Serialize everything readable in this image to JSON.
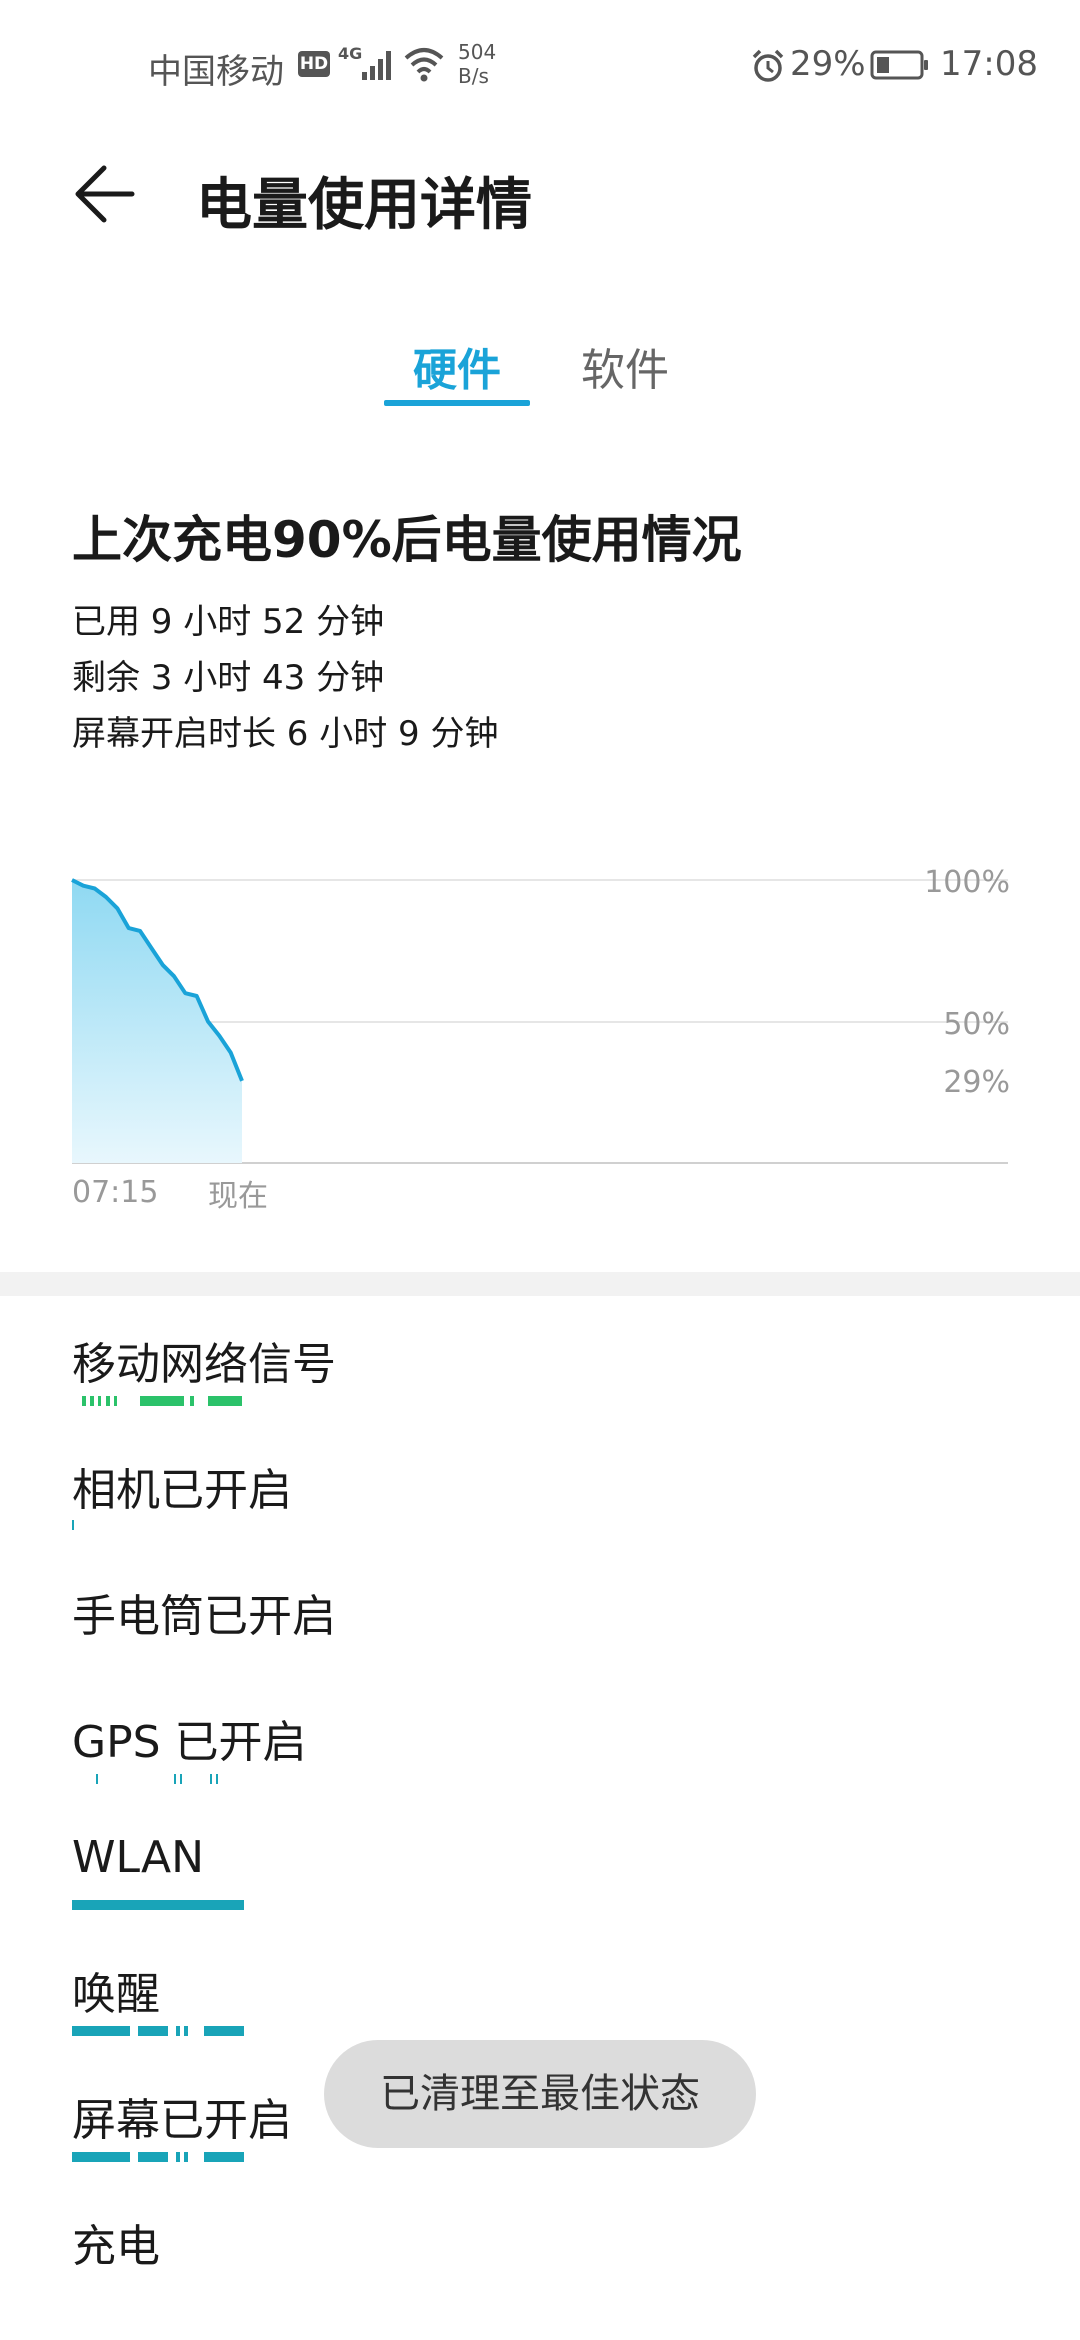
{
  "status_bar": {
    "carrier": "中国移动",
    "hd_badge": "HD",
    "network_type": "4G",
    "net_speed_value": "504",
    "net_speed_unit": "B/s",
    "battery_percent": "29%",
    "time": "17:08",
    "icons": [
      "hd-icon",
      "signal-icon",
      "wifi-icon",
      "alarm-icon",
      "battery-icon"
    ]
  },
  "header": {
    "title": "电量使用详情",
    "back_icon": "back-arrow-icon"
  },
  "tabs": [
    {
      "label": "硬件",
      "active": true
    },
    {
      "label": "软件",
      "active": false
    }
  ],
  "summary": {
    "title": "上次充电90%后电量使用情况",
    "used": "已用 9 小时 52 分钟",
    "remaining": "剩余 3 小时 43 分钟",
    "screen_on": "屏幕开启时长 6 小时 9 分钟"
  },
  "chart_data": {
    "type": "area",
    "title": "",
    "xlabel": "",
    "ylabel": "",
    "ylim": [
      0,
      100
    ],
    "x_ticks": [
      "07:15",
      "现在"
    ],
    "y_ticks": [
      "100%",
      "50%",
      "29%"
    ],
    "series": [
      {
        "values": [
          100,
          98,
          97,
          94,
          90,
          83,
          82,
          76,
          70,
          66,
          60,
          59,
          50,
          45,
          39,
          29
        ]
      }
    ],
    "grid": true,
    "colors": {
      "line": "#1aa3d8",
      "fill_top": "#8fd9f2",
      "fill_bottom": "#e8f7fd",
      "grid": "#e6e6e6"
    }
  },
  "usage_list": {
    "items": [
      {
        "label": "移动网络信号",
        "bar_color": "#2bc26a"
      },
      {
        "label": "相机已开启",
        "bar_color": "#19a4b8"
      },
      {
        "label": "手电筒已开启",
        "bar_color": "#19a4b8"
      },
      {
        "label": "GPS 已开启",
        "bar_color": "#19a4b8"
      },
      {
        "label": "WLAN",
        "bar_color": "#19a4b8"
      },
      {
        "label": "唤醒",
        "bar_color": "#19a4b8"
      },
      {
        "label": "屏幕已开启",
        "bar_color": "#19a4b8"
      },
      {
        "label": "充电",
        "bar_color": "#19a4b8"
      }
    ]
  },
  "toast": {
    "text": "已清理至最佳状态"
  }
}
